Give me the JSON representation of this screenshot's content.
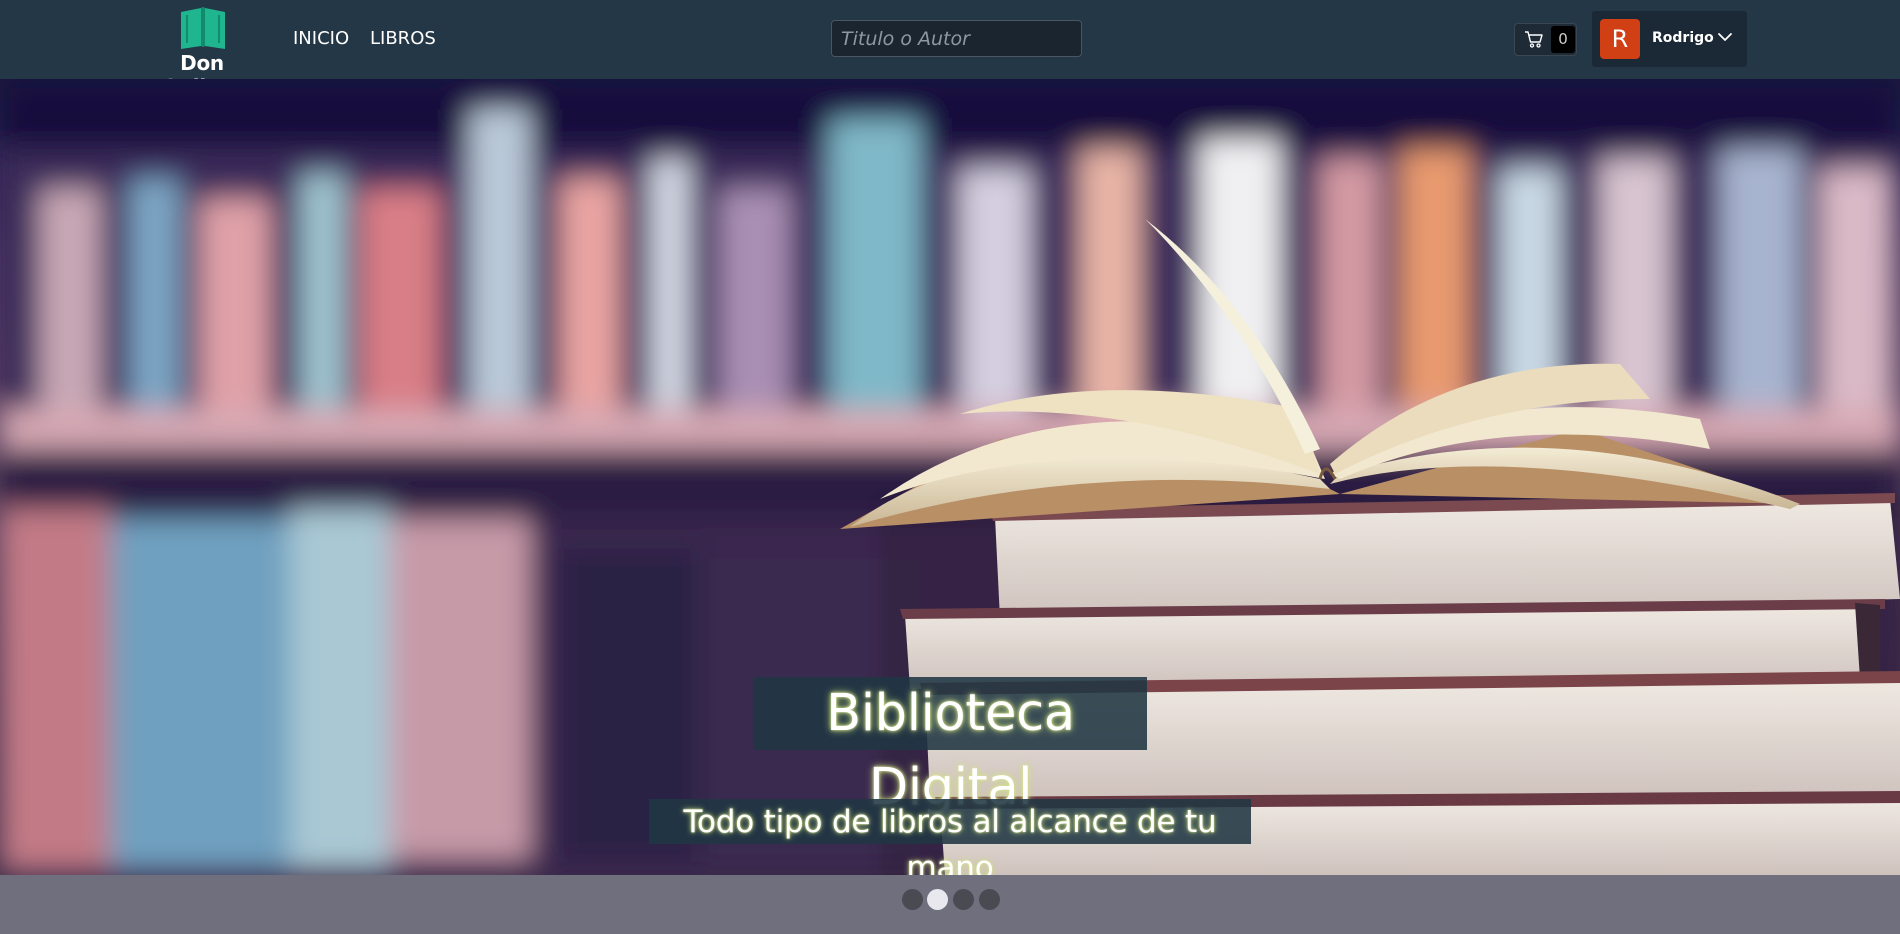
{
  "brand": {
    "name": "Don Quijote",
    "logo_icon": "open-book-icon",
    "logo_color": "#1fb58f"
  },
  "nav": {
    "items": [
      {
        "label": "INICIO"
      },
      {
        "label": "LIBROS"
      }
    ]
  },
  "search": {
    "placeholder": "Titulo o Autor",
    "value": "",
    "icon": "search-icon"
  },
  "cart": {
    "icon": "cart-icon",
    "count": "0"
  },
  "user": {
    "initial": "R",
    "name": "Rodrigo",
    "avatar_color": "#d13f15",
    "menu_icon": "chevron-down-icon"
  },
  "carousel": {
    "title": "Biblioteca Digital",
    "subtitle": "Todo tipo de libros al alcance de tu mano",
    "slide_count": 4,
    "active_index": 1
  },
  "colors": {
    "navbar": "#243746",
    "page_bg": "#6f6f7e",
    "caption_bg": "#203743"
  }
}
